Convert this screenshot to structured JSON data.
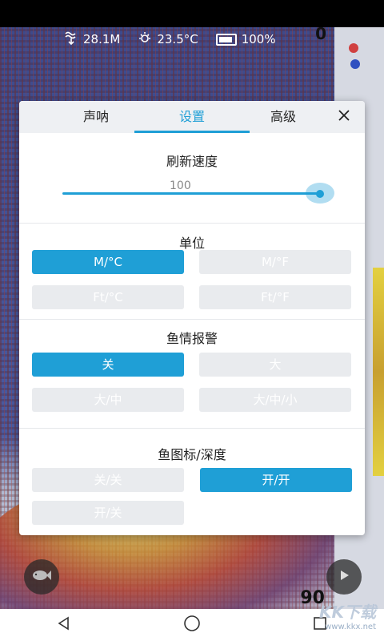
{
  "status_bar": {
    "depth": "28.1M",
    "temperature": "23.5°C",
    "battery": "100%",
    "top_depth": "0",
    "bottom_depth": "90"
  },
  "dialog": {
    "tabs": [
      {
        "label": "声呐",
        "active": false
      },
      {
        "label": "设置",
        "active": true
      },
      {
        "label": "高级",
        "active": false
      }
    ],
    "refresh": {
      "title": "刷新速度",
      "value": "100",
      "fraction": 1.0
    },
    "units": {
      "title": "单位",
      "options": [
        "M/°C",
        "M/°F",
        "Ft/°C",
        "Ft/°F"
      ],
      "selected": "M/°C"
    },
    "fish_alarm": {
      "title": "鱼情报警",
      "options": [
        "关",
        "大",
        "大/中",
        "大/中/小"
      ],
      "selected": "关"
    },
    "fish_icon_depth": {
      "title": "鱼图标/深度",
      "options": [
        "关/关",
        "开/开",
        "开/关"
      ],
      "selected": "开/开"
    }
  },
  "watermark": {
    "text": "KK下载",
    "url": "www.kkx.net"
  },
  "colors": {
    "accent": "#1f9fd6",
    "option_off": "#e9ebee"
  },
  "icons": [
    "depth-icon",
    "sun-icon",
    "battery-icon",
    "close-icon",
    "fish-icon",
    "play-icon",
    "back-icon",
    "home-icon",
    "recent-icon"
  ]
}
